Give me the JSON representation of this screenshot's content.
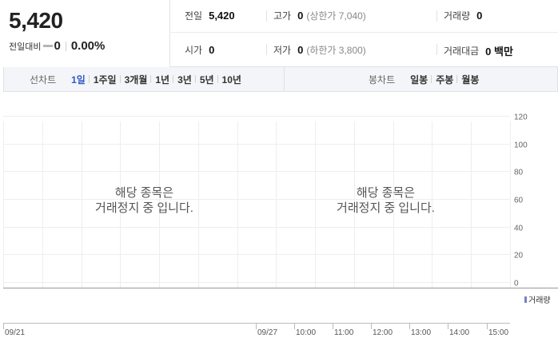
{
  "price": {
    "current": "5,420",
    "change_label": "전일대비",
    "change_value": "0",
    "change_rate": "0.00%"
  },
  "stats": {
    "prev_close": {
      "label": "전일",
      "value": "5,420"
    },
    "high": {
      "label": "고가",
      "value": "0",
      "sub": "(상한가 7,040)"
    },
    "volume": {
      "label": "거래량",
      "value": "0"
    },
    "open": {
      "label": "시가",
      "value": "0"
    },
    "low": {
      "label": "저가",
      "value": "0",
      "sub": "(하한가 3,800)"
    },
    "trade_value": {
      "label": "거래대금",
      "value": "0 백만"
    }
  },
  "toolbar": {
    "line_chart_label": "선차트",
    "line_periods": [
      "1일",
      "1주일",
      "3개월",
      "1년",
      "3년",
      "5년",
      "10년"
    ],
    "active_period": "1일",
    "candle_chart_label": "봉차트",
    "candle_periods": [
      "일봉",
      "주봉",
      "월봉"
    ]
  },
  "chart_data": {
    "type": "line",
    "series": [],
    "y_ticks": [
      "120",
      "100",
      "80",
      "60",
      "40",
      "20",
      "0"
    ],
    "ylim": [
      0,
      120
    ],
    "grid": true,
    "x_labels": [
      "09/21",
      "09/27",
      "10:00",
      "11:00",
      "12:00",
      "13:00",
      "14:00",
      "15:00"
    ],
    "message_left": [
      "해당 종목은",
      "거래정지 중 입니다."
    ],
    "message_right": [
      "해당 종목은",
      "거래정지 중 입니다."
    ],
    "volume_legend": "거래량",
    "volume_color": "#7a80c4"
  }
}
